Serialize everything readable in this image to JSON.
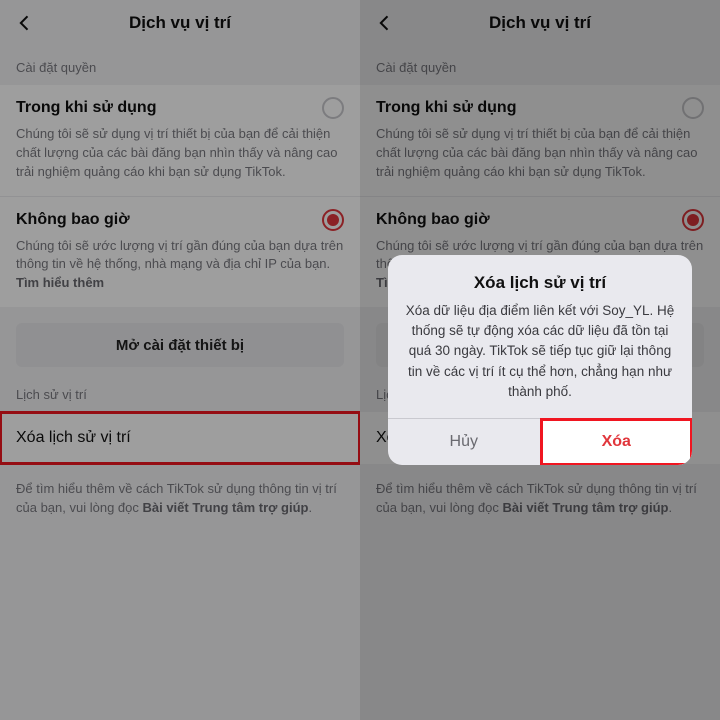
{
  "header": {
    "title": "Dịch vụ vị trí"
  },
  "sections": {
    "permissions_label": "Cài đặt quyền",
    "history_label": "Lịch sử vị trí"
  },
  "options": {
    "while_using": {
      "title": "Trong khi sử dụng",
      "desc": "Chúng tôi sẽ sử dụng vị trí thiết bị của bạn để cải thiện chất lượng của các bài đăng bạn nhìn thấy và nâng cao trải nghiệm quảng cáo khi bạn sử dụng TikTok."
    },
    "never": {
      "title": "Không bao giờ",
      "desc_prefix": "Chúng tôi sẽ ước lượng vị trí gần đúng của bạn dựa trên thông tin về hệ thống, nhà mạng và địa chỉ IP của bạn. ",
      "desc_link": "Tìm hiểu thêm"
    }
  },
  "open_settings_label": "Mở cài đặt thiết bị",
  "delete_history_row": "Xóa lịch sử vị trí",
  "footer": {
    "prefix": "Để tìm hiểu thêm về cách TikTok sử dụng thông tin vị trí của bạn, vui lòng đọc ",
    "link": "Bài viết Trung tâm trợ giúp",
    "suffix": "."
  },
  "modal": {
    "title": "Xóa lịch sử vị trí",
    "body": "Xóa dữ liệu địa điểm liên kết với Soy_YL. Hệ thống sẽ tự động xóa các dữ liệu đã tồn tại quá 30 ngày. TikTok sẽ tiếp tục giữ lại thông tin về các vị trí ít cụ thể hơn, chẳng hạn như thành phố.",
    "cancel": "Hủy",
    "confirm": "Xóa"
  }
}
